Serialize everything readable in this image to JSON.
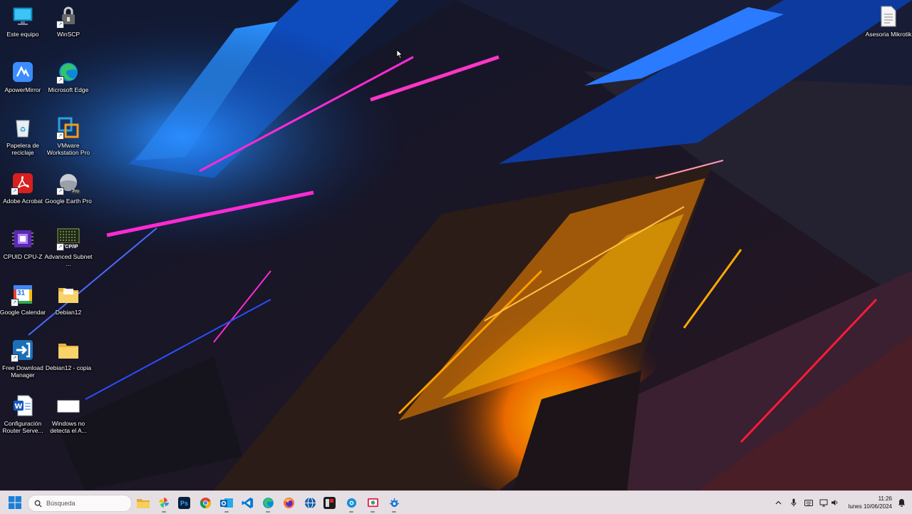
{
  "desktop": {
    "left_icons": [
      {
        "label": "Este equipo",
        "icon": "computer-monitor-icon"
      },
      {
        "label": "WinSCP",
        "icon": "winscp-icon"
      },
      {
        "label": "ApowerMirror",
        "icon": "apowermirror-icon"
      },
      {
        "label": "Microsoft Edge",
        "icon": "edge-icon"
      },
      {
        "label": "Papelera de reciclaje",
        "icon": "recycle-bin-icon"
      },
      {
        "label": "VMware Workstation Pro",
        "icon": "vmware-icon"
      },
      {
        "label": "Adobe Acrobat",
        "icon": "acrobat-icon"
      },
      {
        "label": "Google Earth Pro",
        "icon": "google-earth-icon"
      },
      {
        "label": "CPUID CPU-Z",
        "icon": "cpuz-icon"
      },
      {
        "label": "Advanced Subnet ...",
        "icon": "subnet-calculator-icon"
      },
      {
        "label": "Google Calendar",
        "icon": "google-calendar-icon"
      },
      {
        "label": "Debian12",
        "icon": "folder-icon"
      },
      {
        "label": "Free Download Manager",
        "icon": "download-manager-icon"
      },
      {
        "label": "Debian12 - copia",
        "icon": "folder-icon"
      },
      {
        "label": "Configuración Router Serve...",
        "icon": "word-document-icon"
      },
      {
        "label": "Windows no detecta el A...",
        "icon": "blank-file-icon"
      }
    ],
    "right_icons": [
      {
        "label": "Asesoria Mikrotik",
        "icon": "text-document-icon"
      }
    ],
    "calendar_day": "31",
    "subnet_badge": "TCP/IP",
    "earth_badge": "Pro"
  },
  "taskbar": {
    "search_placeholder": "Búsqueda",
    "apps": [
      {
        "name": "file-explorer",
        "icon": "folder-icon"
      },
      {
        "name": "pinwheel-app",
        "icon": "pinwheel-icon"
      },
      {
        "name": "photoshop",
        "icon": "photoshop-icon",
        "text": "Ps"
      },
      {
        "name": "chrome",
        "icon": "chrome-icon"
      },
      {
        "name": "outlook",
        "icon": "outlook-icon"
      },
      {
        "name": "vscode",
        "icon": "vscode-icon"
      },
      {
        "name": "edge",
        "icon": "edge-icon"
      },
      {
        "name": "firefox",
        "icon": "firefox-icon"
      },
      {
        "name": "network-app",
        "icon": "globe-icon"
      },
      {
        "name": "winbox",
        "icon": "winbox-icon"
      },
      {
        "name": "settings-gear-app",
        "icon": "gear-app-icon"
      },
      {
        "name": "snipping-app",
        "icon": "snip-icon"
      },
      {
        "name": "terminal-app",
        "icon": "bug-gear-icon"
      }
    ],
    "tray": {
      "time": "11:26",
      "date": "lunes 10/06/2024"
    }
  },
  "colors": {
    "taskbar_bg": "#eee8ec",
    "accent_blue": "#1e7fff",
    "accent_magenta": "#ff2ad4",
    "accent_orange": "#ff9a00"
  }
}
